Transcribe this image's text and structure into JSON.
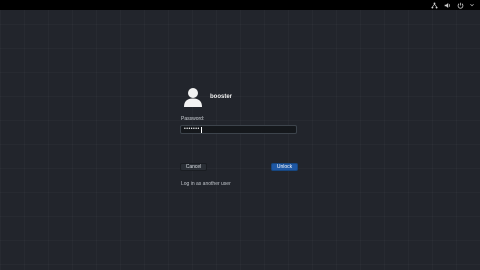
{
  "top_bar": {
    "status_icons": [
      "network-icon",
      "volume-icon",
      "power-icon"
    ]
  },
  "login": {
    "avatar_icon": "user-avatar-icon",
    "username": "booster",
    "password_label": "Password:",
    "password_value": "•••••••",
    "cancel_label": "Cancel",
    "unlock_label": "Unlock",
    "switch_user_label": "Log in as another user"
  },
  "colors": {
    "background": "#22252c",
    "accent": "#1e57a3",
    "top_bar": "#000000"
  }
}
